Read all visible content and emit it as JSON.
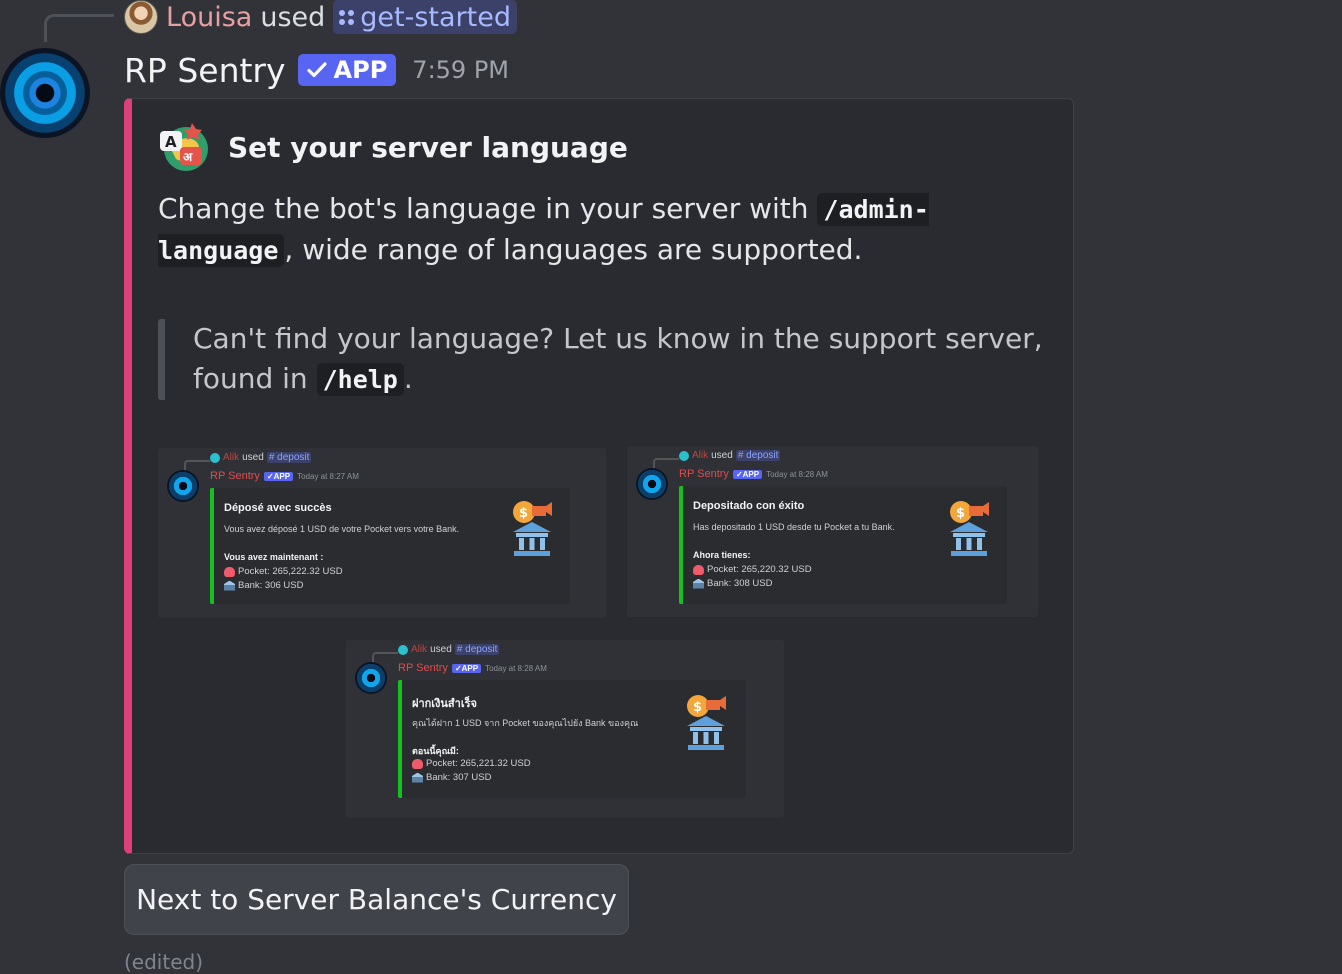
{
  "reply": {
    "user": "Louisa",
    "used": "used",
    "command": "get-started"
  },
  "message": {
    "author": "RP Sentry",
    "app_tag": "APP",
    "timestamp": "7:59 PM",
    "edited": "(edited)"
  },
  "embed": {
    "accent_color": "#dd3f7c",
    "title": "Set your server language",
    "desc_before": "Change the bot's language in your server with ",
    "desc_code": "/admin-language",
    "desc_after": ", wide range of languages are supported.",
    "quote_before": "Can't find your language? Let us know in the support server, found in ",
    "quote_code": "/help",
    "quote_after": "."
  },
  "screenshots": [
    {
      "reply_user": "Alik",
      "used": "used",
      "command": "# deposit",
      "author": "RP Sentry",
      "app": "✓APP",
      "time": "Today at 8:27 AM",
      "title": "Déposé avec succès",
      "desc": "Vous avez déposé 1 USD de votre Pocket vers votre Bank.",
      "now_label": "Vous avez maintenant :",
      "pocket": "Pocket: 265,222.32 USD",
      "bank": "Bank: 306 USD"
    },
    {
      "reply_user": "Alik",
      "used": "used",
      "command": "# deposit",
      "author": "RP Sentry",
      "app": "✓APP",
      "time": "Today at 8:28 AM",
      "title": "Depositado con éxito",
      "desc": "Has depositado 1 USD desde tu Pocket a tu Bank.",
      "now_label": "Ahora tienes:",
      "pocket": "Pocket: 265,220.32 USD",
      "bank": "Bank: 308 USD"
    },
    {
      "reply_user": "Alik",
      "used": "used",
      "command": "# deposit",
      "author": "RP Sentry",
      "app": "✓APP",
      "time": "Today at 8:28 AM",
      "title": "ฝากเงินสำเร็จ",
      "desc": "คุณได้ฝาก 1 USD จาก Pocket ของคุณไปยัง Bank ของคุณ",
      "now_label": "ตอนนี้คุณมี:",
      "pocket": "Pocket: 265,221.32 USD",
      "bank": "Bank: 307 USD"
    }
  ],
  "button": {
    "label": "Next to Server Balance's Currency"
  }
}
